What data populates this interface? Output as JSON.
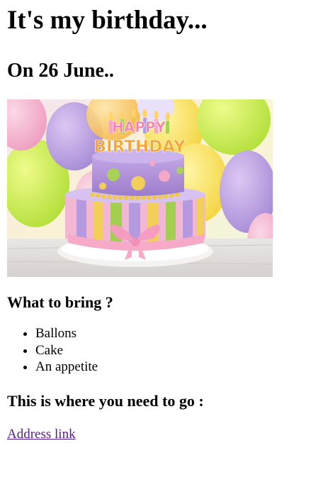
{
  "page": {
    "title": "It's my birthday...",
    "date_heading": "On 26 June..",
    "image_alt": "Happy birthday cake",
    "cake_text": "HAPPY BIRTHDAY",
    "bring_heading": "What to bring ?",
    "bring_items": [
      "Ballons",
      "Cake",
      "An appetite"
    ],
    "where_heading": "This is where you need to go :",
    "address_link": "Address link"
  },
  "colors": {
    "link": "#551a8b",
    "text": "#000000"
  }
}
